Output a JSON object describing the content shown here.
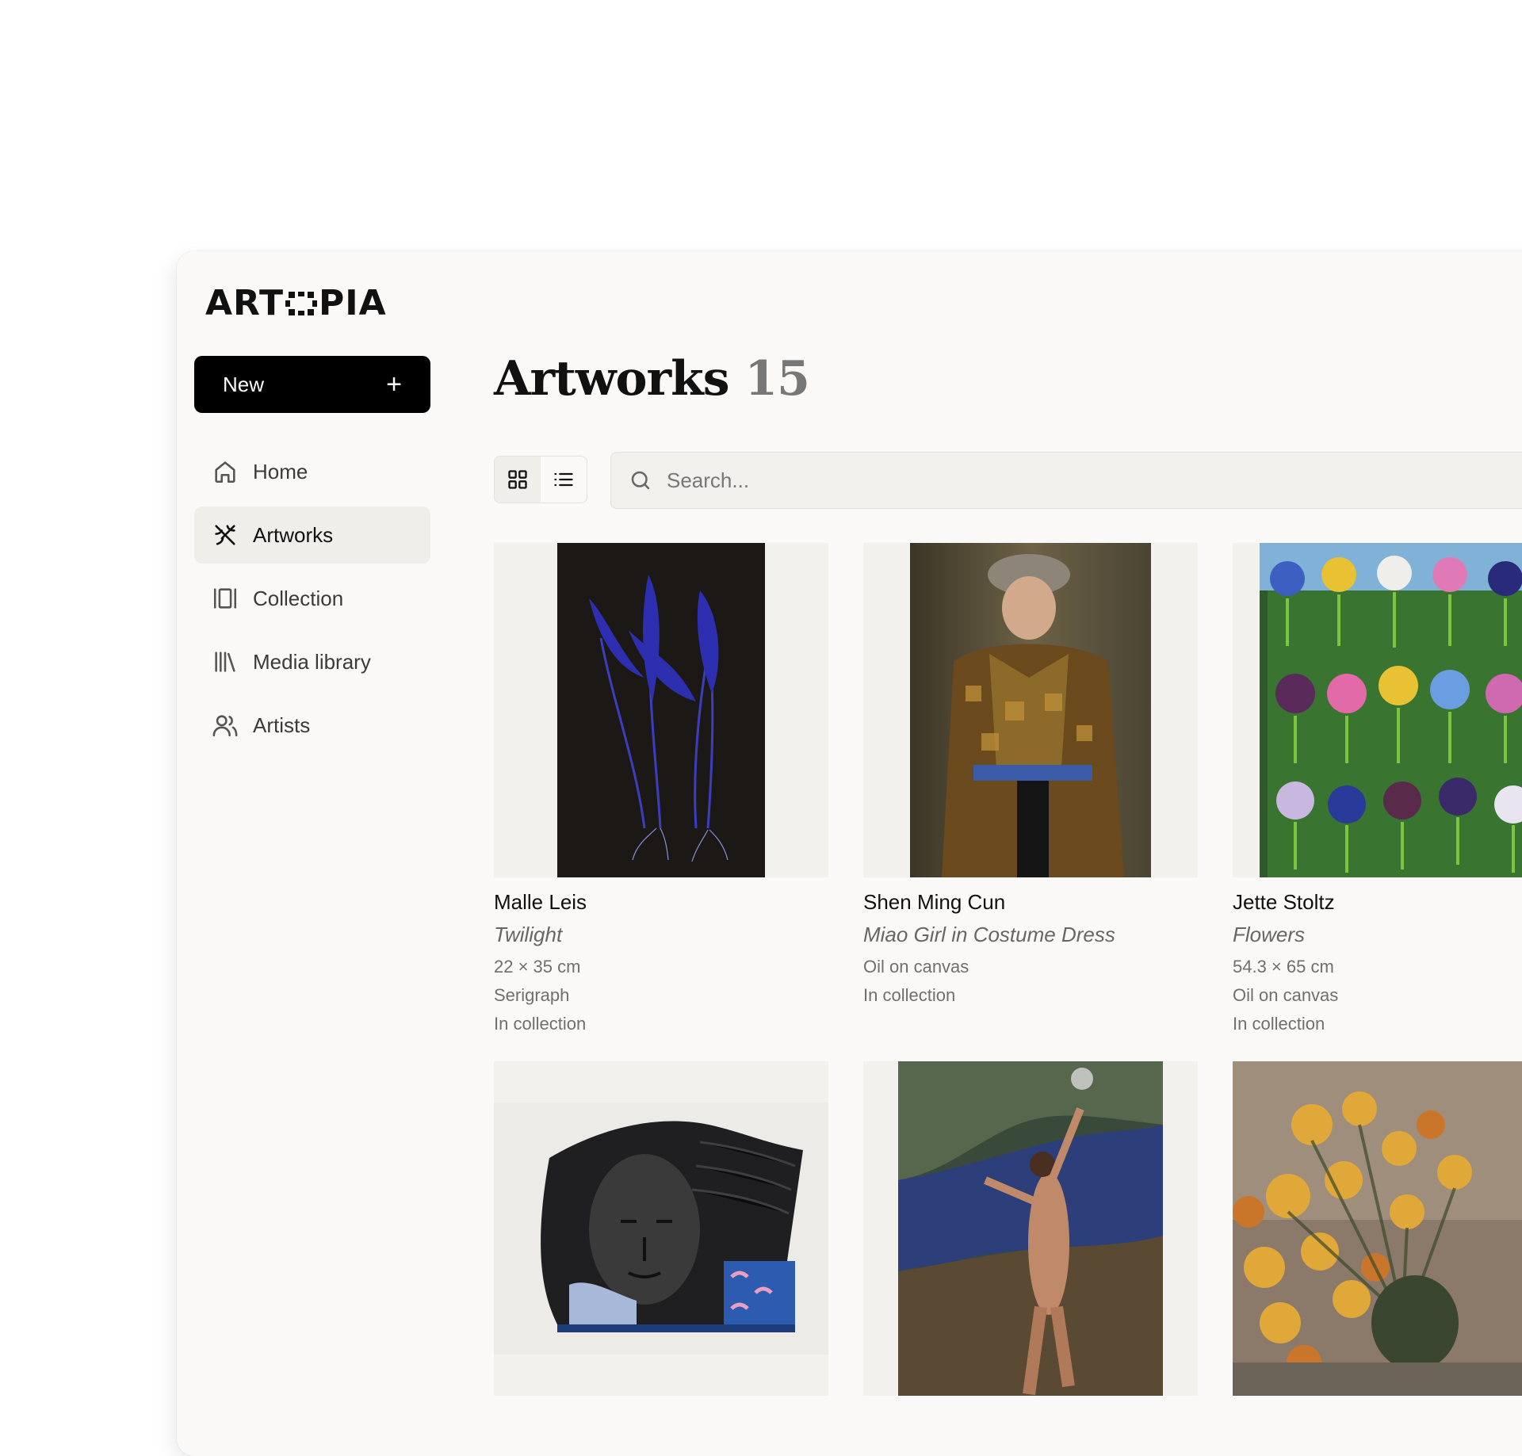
{
  "app": {
    "logo_text_left": "ART",
    "logo_text_right": "PIA"
  },
  "sidebar": {
    "new_label": "New",
    "items": [
      {
        "label": "Home",
        "icon": "home-icon"
      },
      {
        "label": "Artworks",
        "icon": "artworks-icon",
        "active": true
      },
      {
        "label": "Collection",
        "icon": "collection-icon"
      },
      {
        "label": "Media library",
        "icon": "media-library-icon"
      },
      {
        "label": "Artists",
        "icon": "artists-icon"
      }
    ]
  },
  "main": {
    "title": "Artworks",
    "count": "15",
    "search_placeholder": "Search...",
    "view_mode": "grid",
    "artworks": [
      {
        "artist": "Malle Leis",
        "title": "Twilight",
        "details": [
          "22 × 35 cm",
          "Serigraph",
          "In collection"
        ]
      },
      {
        "artist": "Shen Ming Cun",
        "title": "Miao Girl in Costume Dress",
        "details": [
          "Oil on canvas",
          "In collection"
        ]
      },
      {
        "artist": "Jette Stoltz",
        "title": "Flowers",
        "details": [
          "54.3 × 65 cm",
          "Oil on canvas",
          "In collection"
        ]
      },
      {
        "artist": "",
        "title": "",
        "details": []
      },
      {
        "artist": "",
        "title": "",
        "details": []
      },
      {
        "artist": "",
        "title": "",
        "details": []
      }
    ]
  },
  "colors": {
    "background": "#faf9f7",
    "primary_button": "#000000",
    "active_nav": "#efeeeb"
  }
}
